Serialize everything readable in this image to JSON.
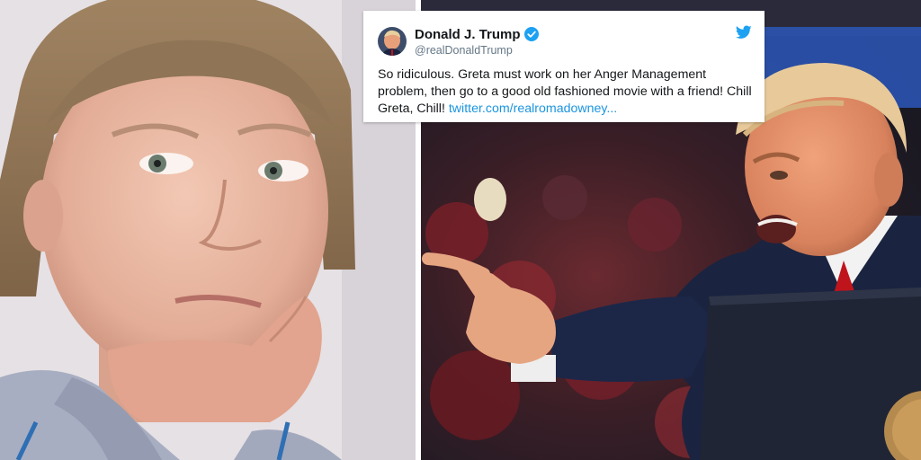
{
  "tweet": {
    "display_name": "Donald J. Trump",
    "handle": "@realDonaldTrump",
    "text": "So ridiculous. Greta must work on her Anger Management problem, then go to a good old fashioned movie with a friend! Chill Greta, Chill!",
    "link_text": "twitter.com/realromadowney...",
    "verified": true
  },
  "icons": [
    "verified-badge-icon",
    "twitter-bird-icon"
  ],
  "colors": {
    "link": "#1b95e0",
    "verified": "#1da1f2",
    "name": "#14171a",
    "handle": "#657786"
  }
}
